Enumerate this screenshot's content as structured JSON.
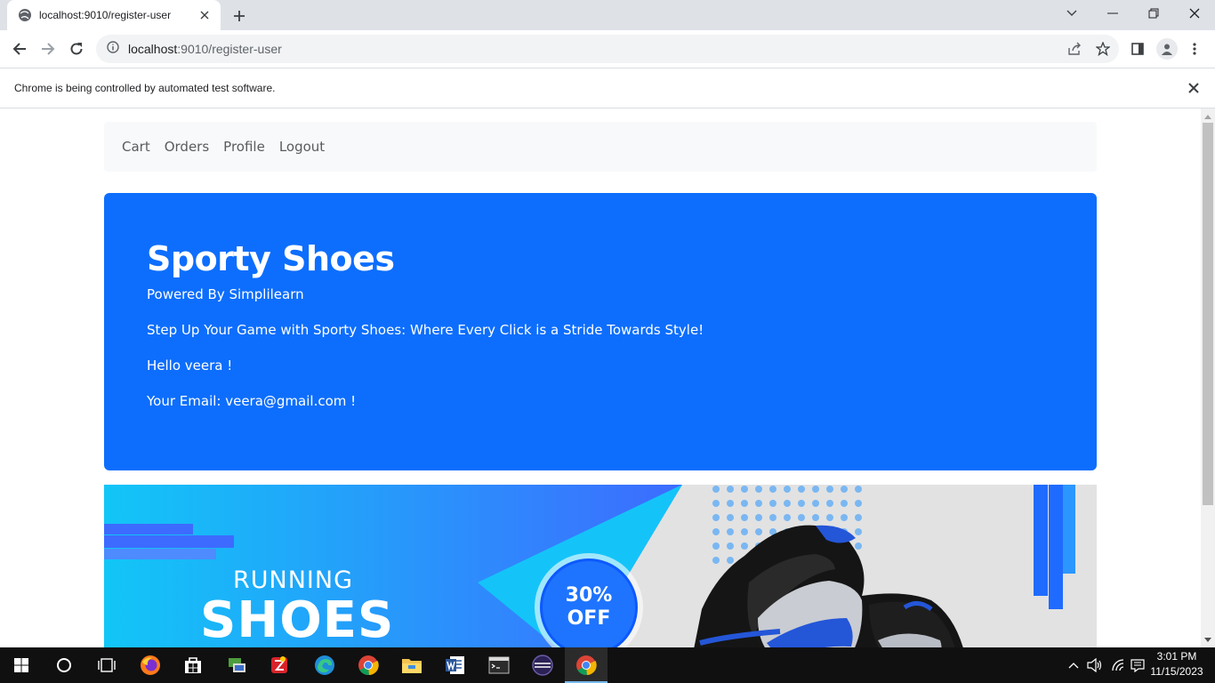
{
  "browser": {
    "tab_title": "localhost:9010/register-user",
    "url_host": "localhost",
    "url_path": ":9010/register-user",
    "infobar_message": "Chrome is being controlled by automated test software."
  },
  "nav": {
    "items": [
      "Cart",
      "Orders",
      "Profile",
      "Logout"
    ]
  },
  "hero": {
    "title": "Sporty Shoes",
    "subtitle": "Powered By Simplilearn",
    "tagline": "Step Up Your Game with Sporty Shoes: Where Every Click is a Stride Towards Style!",
    "greeting": "Hello veera !",
    "email_line": "Your Email: veera@gmail.com !"
  },
  "banner": {
    "line1": "RUNNING",
    "line2": "SHOES",
    "badge_pct": "30%",
    "badge_off": "OFF"
  },
  "taskbar": {
    "time": "3:01 PM",
    "date": "11/15/2023"
  },
  "colors": {
    "primary": "#0d6efd",
    "nav_bg": "#f8f9fa",
    "taskbar_bg": "#101010"
  }
}
